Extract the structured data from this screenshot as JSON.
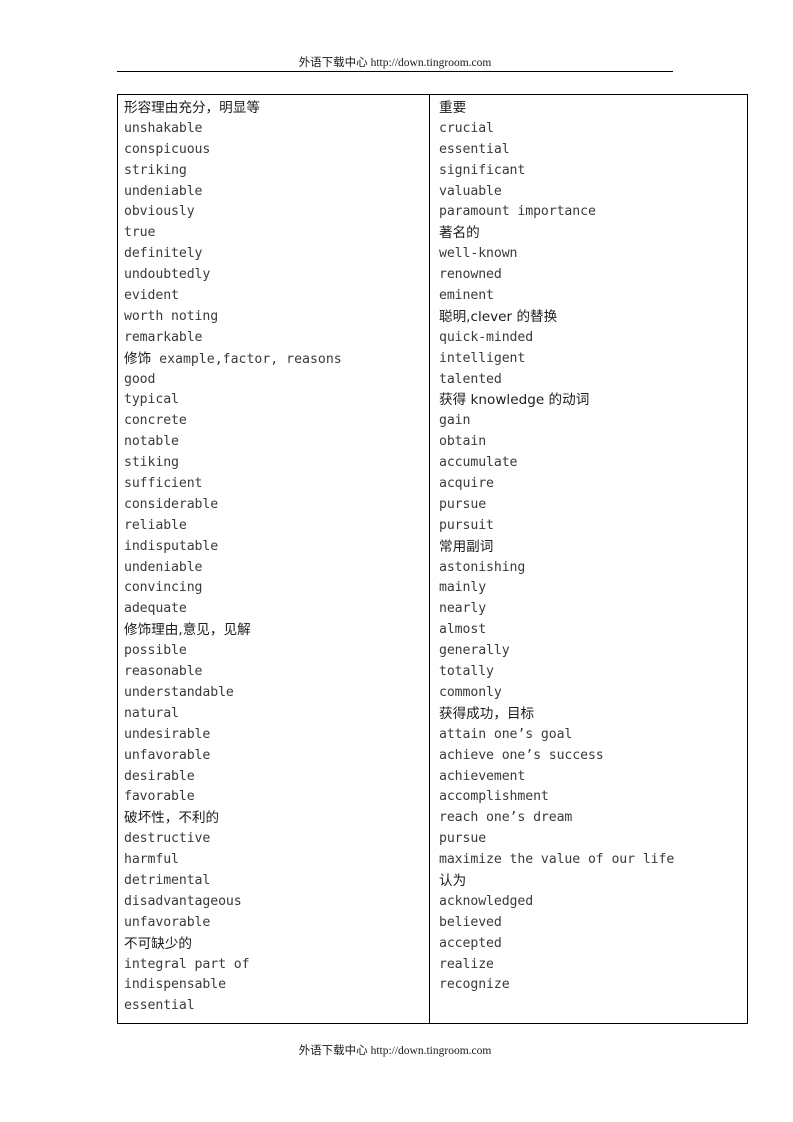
{
  "header": {
    "cjk": "外语下载中心",
    "url": " http://down.tingroom.com"
  },
  "footer": {
    "cjk": "外语下载中心",
    "url": " http://down.tingroom.com"
  },
  "table": {
    "left_column": [
      {
        "text": "形容理由充分，明显等",
        "type": "category"
      },
      {
        "text": "unshakable",
        "type": "word"
      },
      {
        "text": "conspicuous",
        "type": "word"
      },
      {
        "text": "striking",
        "type": "word"
      },
      {
        "text": "undeniable",
        "type": "word"
      },
      {
        "text": "obviously",
        "type": "word"
      },
      {
        "text": "true",
        "type": "word"
      },
      {
        "text": "definitely",
        "type": "word"
      },
      {
        "text": "undoubtedly",
        "type": "word"
      },
      {
        "text": "evident",
        "type": "word"
      },
      {
        "text": "worth noting",
        "type": "word"
      },
      {
        "text": "remarkable",
        "type": "word"
      },
      {
        "text": "修饰 example,factor, reasons",
        "type": "category",
        "cjk_prefix": "修饰",
        "latin_rest": " example,factor, reasons"
      },
      {
        "text": "good",
        "type": "word"
      },
      {
        "text": "typical",
        "type": "word"
      },
      {
        "text": "concrete",
        "type": "word"
      },
      {
        "text": "notable",
        "type": "word"
      },
      {
        "text": "stiking",
        "type": "word"
      },
      {
        "text": "sufficient",
        "type": "word"
      },
      {
        "text": "considerable",
        "type": "word"
      },
      {
        "text": "reliable",
        "type": "word"
      },
      {
        "text": "indisputable",
        "type": "word"
      },
      {
        "text": "undeniable",
        "type": "word"
      },
      {
        "text": "convincing",
        "type": "word"
      },
      {
        "text": "adequate",
        "type": "word"
      },
      {
        "text": "修饰理由,意见，见解",
        "type": "category"
      },
      {
        "text": "possible",
        "type": "word"
      },
      {
        "text": "reasonable",
        "type": "word"
      },
      {
        "text": "understandable",
        "type": "word"
      },
      {
        "text": "natural",
        "type": "word"
      },
      {
        "text": "undesirable",
        "type": "word"
      },
      {
        "text": "unfavorable",
        "type": "word"
      },
      {
        "text": "desirable",
        "type": "word"
      },
      {
        "text": "favorable",
        "type": "word"
      },
      {
        "text": "破坏性，不利的",
        "type": "category"
      },
      {
        "text": "destructive",
        "type": "word"
      },
      {
        "text": "harmful",
        "type": "word"
      },
      {
        "text": "detrimental",
        "type": "word"
      },
      {
        "text": "disadvantageous",
        "type": "word"
      },
      {
        "text": "unfavorable",
        "type": "word"
      },
      {
        "text": "不可缺少的",
        "type": "category"
      },
      {
        "text": "integral part of",
        "type": "word"
      },
      {
        "text": "indispensable",
        "type": "word"
      },
      {
        "text": "essential",
        "type": "word"
      }
    ],
    "right_column": [
      {
        "text": "重要",
        "type": "category"
      },
      {
        "text": "crucial",
        "type": "word"
      },
      {
        "text": "essential",
        "type": "word"
      },
      {
        "text": "significant",
        "type": "word"
      },
      {
        "text": "valuable",
        "type": "word"
      },
      {
        "text": "paramount importance",
        "type": "word"
      },
      {
        "text": "著名的",
        "type": "category"
      },
      {
        "text": "well-known",
        "type": "word"
      },
      {
        "text": "renowned",
        "type": "word"
      },
      {
        "text": "eminent",
        "type": "word"
      },
      {
        "text": "聪明,clever 的替换",
        "type": "category"
      },
      {
        "text": "quick-minded",
        "type": "word"
      },
      {
        "text": "intelligent",
        "type": "word"
      },
      {
        "text": "talented",
        "type": "word"
      },
      {
        "text": "获得 knowledge 的动词",
        "type": "category"
      },
      {
        "text": "gain",
        "type": "word"
      },
      {
        "text": "obtain",
        "type": "word"
      },
      {
        "text": "accumulate",
        "type": "word"
      },
      {
        "text": "acquire",
        "type": "word"
      },
      {
        "text": "pursue",
        "type": "word"
      },
      {
        "text": "pursuit",
        "type": "word"
      },
      {
        "text": "常用副词",
        "type": "category"
      },
      {
        "text": "astonishing",
        "type": "word"
      },
      {
        "text": "mainly",
        "type": "word"
      },
      {
        "text": "nearly",
        "type": "word"
      },
      {
        "text": "almost",
        "type": "word"
      },
      {
        "text": "generally",
        "type": "word"
      },
      {
        "text": "totally",
        "type": "word"
      },
      {
        "text": "commonly",
        "type": "word"
      },
      {
        "text": "获得成功，目标",
        "type": "category"
      },
      {
        "text": "attain one’s goal",
        "type": "word"
      },
      {
        "text": "achieve one’s success",
        "type": "word"
      },
      {
        "text": "achievement",
        "type": "word"
      },
      {
        "text": "accomplishment",
        "type": "word"
      },
      {
        "text": "reach one’s dream",
        "type": "word"
      },
      {
        "text": "pursue",
        "type": "word"
      },
      {
        "text": "maximize the value of our life",
        "type": "word"
      },
      {
        "text": "认为",
        "type": "category"
      },
      {
        "text": "acknowledged",
        "type": "word"
      },
      {
        "text": "believed",
        "type": "word"
      },
      {
        "text": "accepted",
        "type": "word"
      },
      {
        "text": "realize",
        "type": "word"
      },
      {
        "text": "recognize",
        "type": "word"
      }
    ]
  }
}
